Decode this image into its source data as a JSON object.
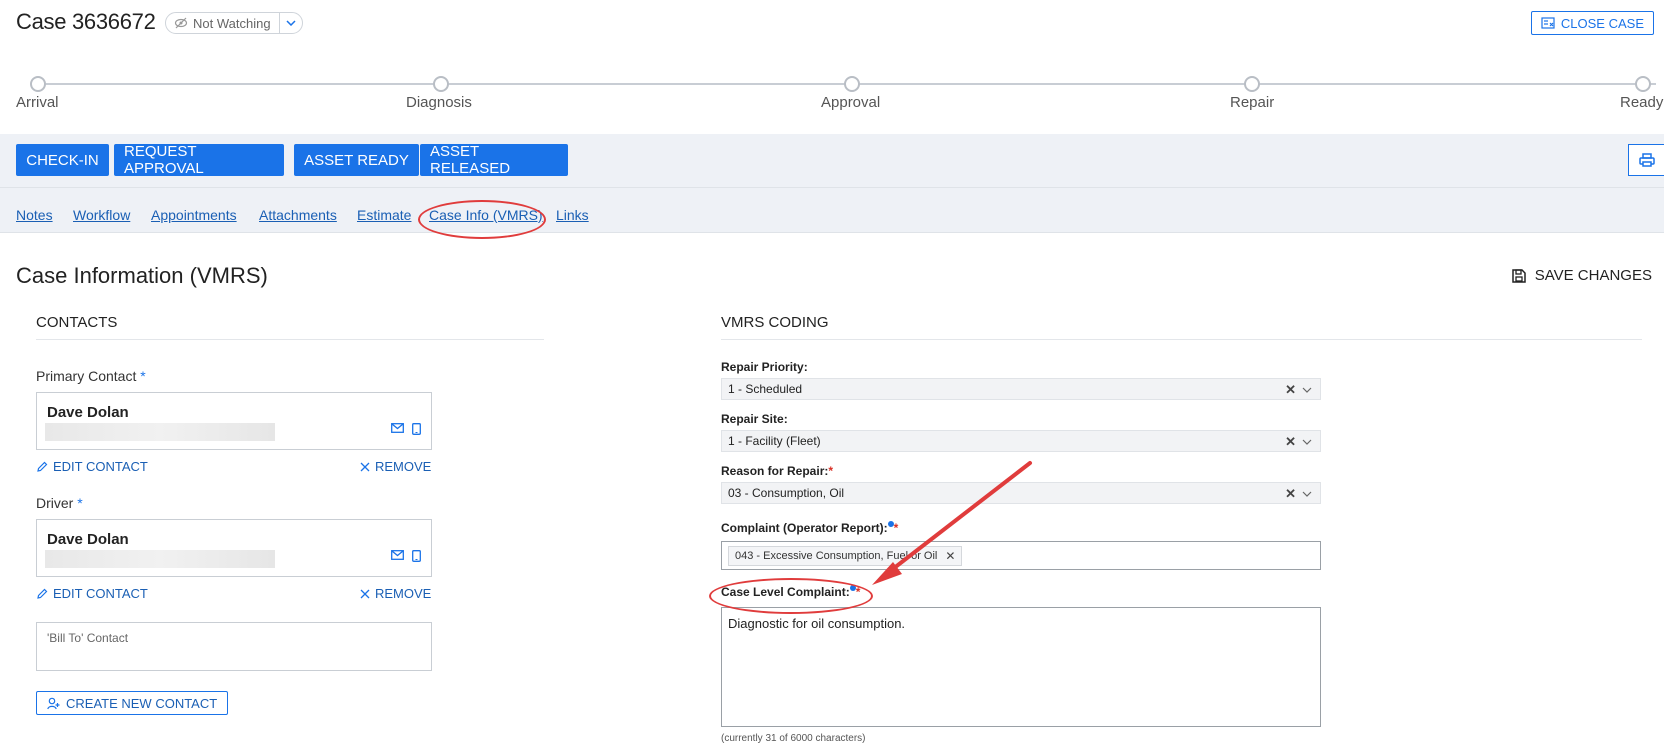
{
  "header": {
    "case_title": "Case 3636672",
    "watch_label": "Not Watching",
    "close_case": "CLOSE CASE"
  },
  "progress": {
    "steps": [
      "Arrival",
      "Diagnosis",
      "Approval",
      "Repair",
      "Ready"
    ]
  },
  "actions": {
    "check_in": "CHECK-IN",
    "request_approval": "REQUEST APPROVAL",
    "asset_ready": "ASSET READY",
    "asset_released": "ASSET RELEASED"
  },
  "tabs": [
    "Notes",
    "Workflow",
    "Appointments",
    "Attachments",
    "Estimate",
    "Case Info (VMRS)",
    "Links"
  ],
  "page": {
    "title": "Case Information (VMRS)",
    "save_changes": "SAVE CHANGES"
  },
  "contacts": {
    "section_title": "CONTACTS",
    "primary_label": "Primary Contact",
    "primary_name": "Dave Dolan",
    "driver_label": "Driver",
    "driver_name": "Dave Dolan",
    "edit_contact": "EDIT CONTACT",
    "remove": "REMOVE",
    "bill_to_placeholder": "'Bill To' Contact",
    "create_new": "CREATE NEW CONTACT"
  },
  "vmrs": {
    "section_title": "VMRS CODING",
    "repair_priority_label": "Repair Priority:",
    "repair_priority_value": "1 - Scheduled",
    "repair_site_label": "Repair Site:",
    "repair_site_value": "1 - Facility (Fleet)",
    "reason_label": "Reason for Repair:",
    "reason_value": "03 - Consumption, Oil",
    "complaint_label": "Complaint (Operator Report):",
    "complaint_chip": "043 - Excessive Consumption, Fuel or Oil",
    "case_complaint_label": "Case Level Complaint:",
    "case_complaint_value": "Diagnostic for oil consumption.",
    "char_count": "(currently 31 of 6000 characters)"
  },
  "colors": {
    "accent": "#1a73e8",
    "annotation": "#e03c3c",
    "bar_bg": "#eef1f6"
  }
}
